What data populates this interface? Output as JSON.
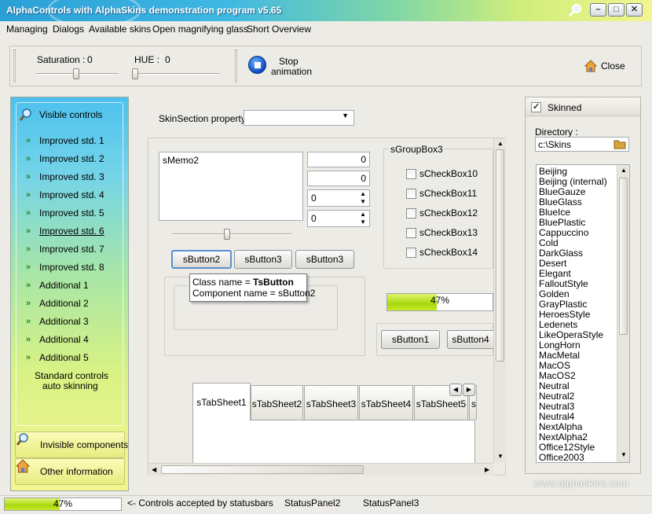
{
  "window": {
    "title": "AlphaControls with AlphaSkins demonstration program v5.65",
    "controls": {
      "minimize": "–",
      "maximize": "□",
      "close": "✕"
    }
  },
  "menu": [
    "Managing",
    "Dialogs",
    "Available skins",
    "Open magnifying glass",
    "Short Overview"
  ],
  "toolbar": {
    "saturation_label": "Saturation :",
    "saturation_value": "0",
    "hue_label": "HUE :",
    "hue_value": "0",
    "stop_label_line1": "Stop",
    "stop_label_line2": "animation",
    "close_label": "Close"
  },
  "left_panel": {
    "header": "Visible controls",
    "items": [
      "Improved std. 1",
      "Improved std. 2",
      "Improved std. 3",
      "Improved std. 4",
      "Improved std. 5",
      "Improved std. 6",
      "Improved std. 7",
      "Improved std. 8",
      "Additional 1",
      "Additional 2",
      "Additional 3",
      "Additional 4",
      "Additional 5"
    ],
    "footer_line1": "Standard controls",
    "footer_line2": "auto skinning",
    "invisible_components": "Invisible components",
    "other_information": "Other information"
  },
  "main": {
    "skinsection_label": "SkinSection property :",
    "skinsection_value": "",
    "memo_text": "sMemo2",
    "edit1_value": "0",
    "edit2_value": "0",
    "spin1_value": "0",
    "spin2_value": "0",
    "buttons": [
      "sButton2",
      "sButton3",
      "sButton3"
    ],
    "tooltip": {
      "class_prefix": "Class name = ",
      "class_value": "TsButton",
      "component": "Component name = sButton2"
    },
    "groupbox_title": "sGroupBox3",
    "checkboxes": [
      "sCheckBox10",
      "sCheckBox11",
      "sCheckBox12",
      "sCheckBox13",
      "sCheckBox14"
    ],
    "progress_value": 47,
    "progress_text": "47%",
    "lower_buttons": [
      "sButton1",
      "sButton4"
    ],
    "tabs": [
      "sTabSheet1",
      "sTabSheet2",
      "sTabSheet3",
      "sTabSheet4",
      "sTabSheet5",
      "s"
    ]
  },
  "right_panel": {
    "skinned_label": "Skinned",
    "skinned_checked": true,
    "directory_label": "Directory :",
    "directory_value": "c:\\Skins",
    "skins": [
      "Beijing",
      "Beijing (internal)",
      "BlueGauze",
      "BlueGlass",
      "BlueIce",
      "BluePlastic",
      "Cappuccino",
      "Cold",
      "DarkGlass",
      "Desert",
      "Elegant",
      "FalloutStyle",
      "Golden",
      "GrayPlastic",
      "HeroesStyle",
      "Ledenets",
      "LikeOperaStyle",
      "LongHorn",
      "MacMetal",
      "MacOS",
      "MacOS2",
      "Neutral",
      "Neutral2",
      "Neutral3",
      "Neutral4",
      "NextAlpha",
      "NextAlpha2",
      "Office12Style",
      "Office2003"
    ],
    "website": "www.alphaskins.com"
  },
  "status_bar": {
    "progress_value": 47,
    "progress_text": "47%",
    "panel1": "<- Controls accepted by statusbars",
    "panel2": "StatusPanel2",
    "panel3": "StatusPanel3"
  },
  "colors": {
    "accent_blue": "#2a9fd6",
    "progress_green": "#a7d70e",
    "menu_arrow_green": "#29862a"
  }
}
